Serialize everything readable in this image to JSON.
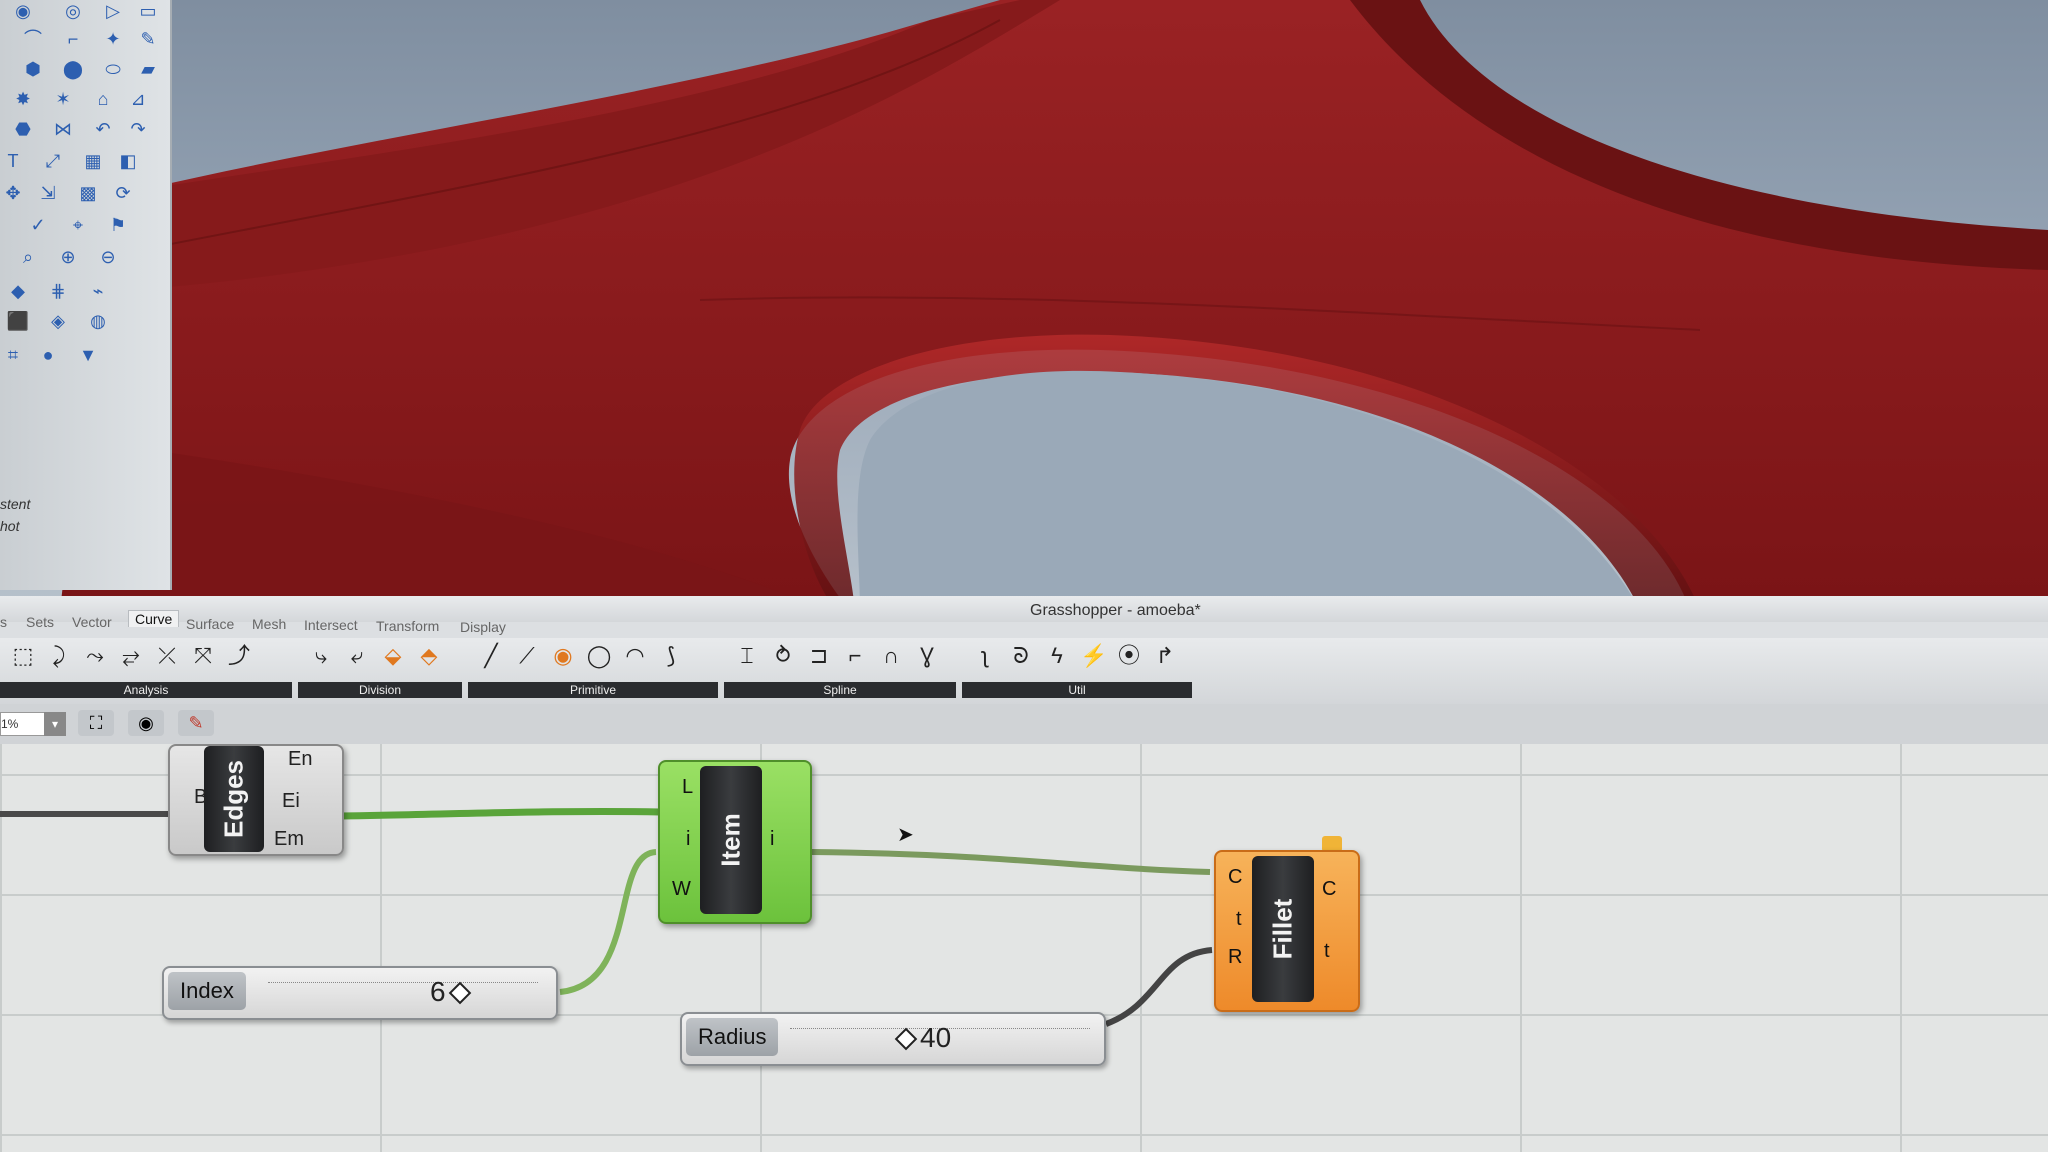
{
  "viewport": {
    "side_labels": [
      "stent",
      "hot"
    ]
  },
  "grasshopper": {
    "title": "Grasshopper - amoeba*",
    "menu_tabs": [
      "s",
      "Sets",
      "Vector",
      "Curve",
      "Surface",
      "Mesh",
      "Intersect",
      "Transform",
      "Display"
    ],
    "active_tab": "Curve",
    "ribbon_groups": [
      "Analysis",
      "Division",
      "Primitive",
      "Spline",
      "Util"
    ],
    "zoom_value": "1%",
    "canvas": {
      "edges": {
        "name": "Edges",
        "inputs": [
          "B"
        ],
        "outputs": [
          "En",
          "Ei",
          "Em"
        ]
      },
      "item": {
        "name": "Item",
        "inputs": [
          "L",
          "i",
          "W"
        ],
        "outputs": [
          "i"
        ]
      },
      "fillet": {
        "name": "Fillet",
        "inputs": [
          "C",
          "t",
          "R"
        ],
        "outputs": [
          "C",
          "t"
        ]
      },
      "index_slider": {
        "label": "Index",
        "value": "6"
      },
      "radius_slider": {
        "label": "Radius",
        "value": "40"
      }
    }
  },
  "colors": {
    "model_red": "#8e1a1c",
    "item_green": "#7ed14b",
    "fillet_orange": "#f39a3c",
    "wire_green": "#5aa43a"
  }
}
